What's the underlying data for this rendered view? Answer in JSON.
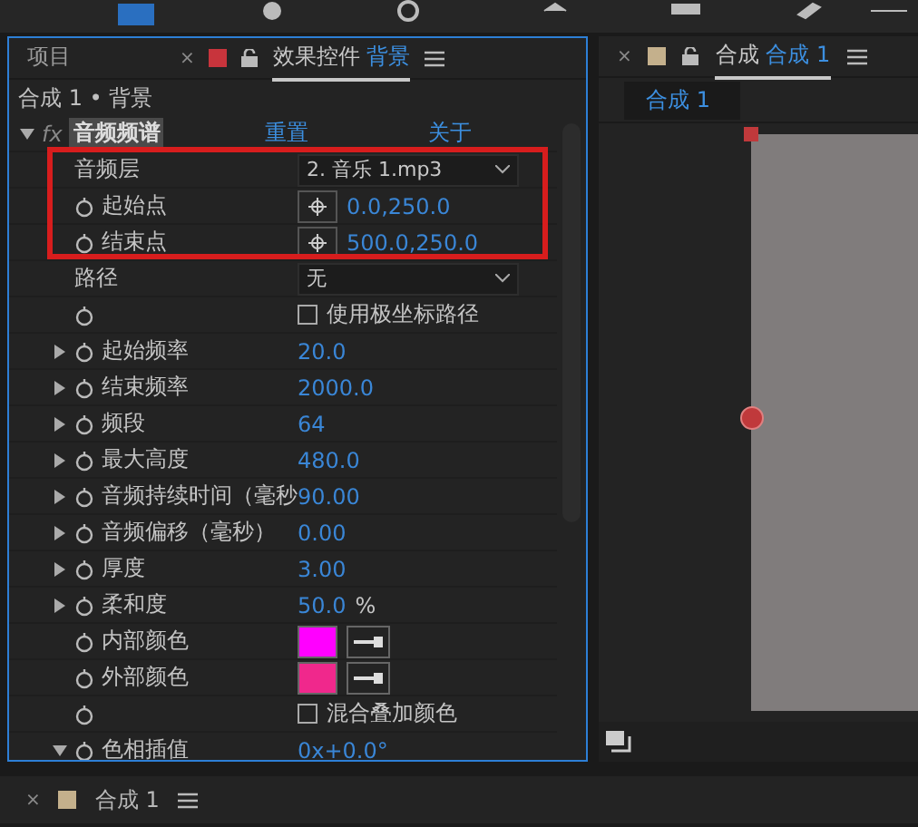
{
  "effects_panel": {
    "tabs": [
      {
        "label": "项目",
        "selected": false
      },
      {
        "label": "效果控件",
        "layer": "背景",
        "close": "×",
        "selected": true
      }
    ],
    "breadcrumb": "合成 1 • 背景",
    "effect": {
      "badge": "fx",
      "name": "音频频谱",
      "expanded": true,
      "reset": "重置",
      "about": "关于"
    },
    "properties": [
      {
        "kind": "dropdown",
        "label": "音频层",
        "value": "2. 音乐 1.mp3"
      },
      {
        "kind": "point",
        "label": "起始点",
        "value": "0.0,250.0"
      },
      {
        "kind": "point",
        "label": "结束点",
        "value": "500.0,250.0"
      },
      {
        "kind": "dropdown",
        "label": "路径",
        "value": "无"
      },
      {
        "kind": "checkbox",
        "label": "使用极坐标路径",
        "checked": false
      },
      {
        "kind": "number",
        "label": "起始频率",
        "value": "20.0",
        "expanded": false
      },
      {
        "kind": "number",
        "label": "结束频率",
        "value": "2000.0",
        "expanded": false
      },
      {
        "kind": "number",
        "label": "频段",
        "value": "64",
        "expanded": false
      },
      {
        "kind": "number",
        "label": "最大高度",
        "value": "480.0",
        "expanded": false
      },
      {
        "kind": "number",
        "label": "音频持续时间（毫秒",
        "value": "90.00",
        "expanded": false
      },
      {
        "kind": "number",
        "label": "音频偏移（毫秒）",
        "value": "0.00",
        "expanded": false
      },
      {
        "kind": "number",
        "label": "厚度",
        "value": "3.00",
        "expanded": false
      },
      {
        "kind": "number",
        "label": "柔和度",
        "value": "50.0",
        "unit": "%",
        "expanded": false
      },
      {
        "kind": "color",
        "label": "内部颜色",
        "color": "#ff00ff"
      },
      {
        "kind": "color",
        "label": "外部颜色",
        "color": "#f0288c"
      },
      {
        "kind": "checkbox",
        "label": "混合叠加颜色",
        "checked": false
      },
      {
        "kind": "number",
        "label": "色相插值",
        "value": "0x+0.0°",
        "expanded": true
      }
    ]
  },
  "composition_panel": {
    "close": "×",
    "title": "合成",
    "comp": "合成 1",
    "subtab": "合成 1"
  },
  "timeline_tab": {
    "close": "×",
    "label": "合成 1"
  }
}
